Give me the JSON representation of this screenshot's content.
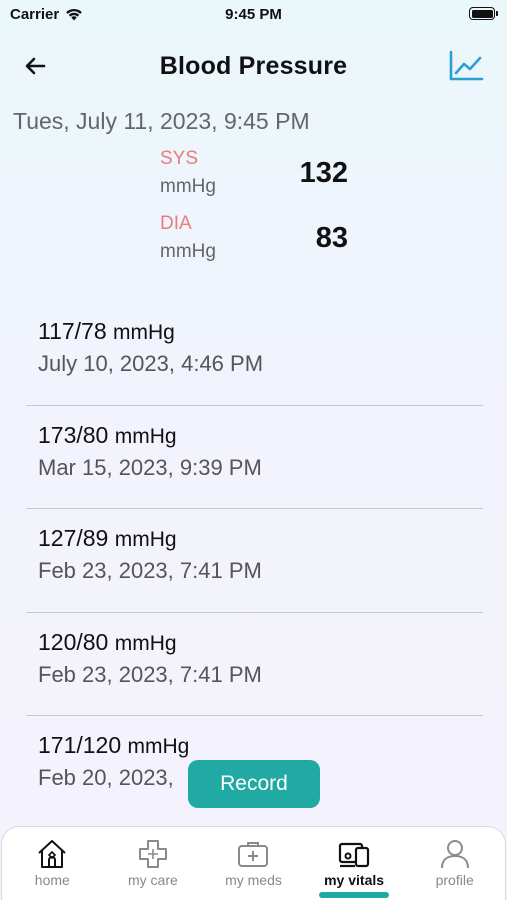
{
  "status_bar": {
    "carrier": "Carrier",
    "time": "9:45 PM"
  },
  "header": {
    "title": "Blood Pressure",
    "back_icon": "arrow-left-icon",
    "chart_icon": "line-chart-icon"
  },
  "current_reading": {
    "date": "Tues, July 11, 2023, 9:45 PM",
    "systolic": {
      "label": "SYS",
      "unit": "mmHg",
      "value": "132"
    },
    "diastolic": {
      "label": "DIA",
      "unit": "mmHg",
      "value": "83"
    }
  },
  "history": [
    {
      "value": "117/78",
      "unit": "mmHg",
      "date": "July 10, 2023, 4:46 PM"
    },
    {
      "value": "173/80",
      "unit": "mmHg",
      "date": "Mar 15, 2023, 9:39 PM"
    },
    {
      "value": "127/89",
      "unit": "mmHg",
      "date": "Feb 23, 2023, 7:41 PM"
    },
    {
      "value": "120/80",
      "unit": "mmHg",
      "date": "Feb 23, 2023, 7:41 PM"
    },
    {
      "value": "171/120",
      "unit": "mmHg",
      "date": "Feb 20, 2023,"
    }
  ],
  "record_button": {
    "label": "Record"
  },
  "tabs": [
    {
      "label": "home",
      "icon": "home-icon",
      "active": false
    },
    {
      "label": "my care",
      "icon": "medical-cross-icon",
      "active": false
    },
    {
      "label": "my meds",
      "icon": "medicine-kit-icon",
      "active": false
    },
    {
      "label": "my vitals",
      "icon": "vitals-devices-icon",
      "active": true
    },
    {
      "label": "profile",
      "icon": "person-icon",
      "active": false
    }
  ],
  "colors": {
    "accent": "#21aaa4",
    "sys_dia_label": "#ec7b7b",
    "chart_icon": "#2a9fd6"
  }
}
